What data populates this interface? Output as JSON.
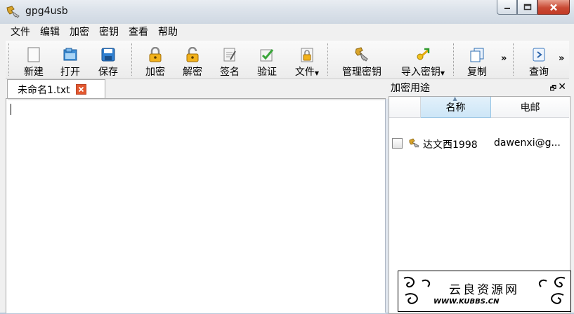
{
  "app": {
    "title": "gpg4usb"
  },
  "menu": [
    "文件",
    "编辑",
    "加密",
    "密钥",
    "查看",
    "帮助"
  ],
  "toolbar": {
    "new": "新建",
    "open": "打开",
    "save": "保存",
    "encrypt": "加密",
    "decrypt": "解密",
    "sign": "签名",
    "verify": "验证",
    "file": "文件",
    "manage_keys": "管理密钥",
    "import_key": "导入密钥",
    "copy": "复制",
    "query": "查询",
    "overflow": "»"
  },
  "editor": {
    "tab_label": "未命名1.txt",
    "content": ""
  },
  "key_panel": {
    "title": "加密用途",
    "columns": [
      "名称",
      "电邮"
    ],
    "rows": [
      {
        "name": "达文西1998",
        "email": "dawenxi@g...",
        "checked": false
      }
    ]
  },
  "watermark": {
    "cn": "云良资源网",
    "en": "WWW.KUBBS.CN"
  },
  "colors": {
    "close_button": "#c94a35",
    "tab_close": "#e2582f",
    "sorted_header": "#cde6f7"
  },
  "icons": {
    "app": "gpg4usb-key-icon",
    "new": "blank-document-icon",
    "open": "folder-open-icon",
    "save": "floppy-disk-icon",
    "encrypt": "padlock-closed-icon",
    "decrypt": "padlock-open-icon",
    "sign": "document-sign-icon",
    "verify": "checkmark-icon",
    "file": "file-lock-icon",
    "manage_keys": "keys-icon",
    "import_key": "key-import-icon",
    "copy": "copy-icon",
    "query": "search-forward-icon"
  }
}
